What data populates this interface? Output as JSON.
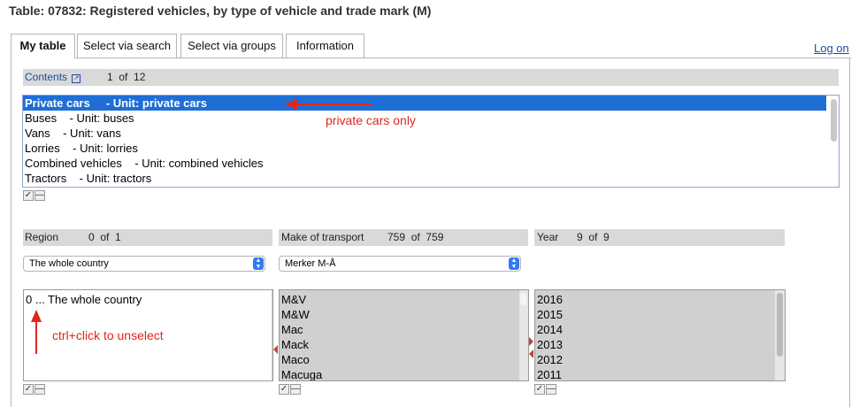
{
  "header": {
    "title": "Table: 07832: Registered vehicles, by type of vehicle and trade mark (M)"
  },
  "tabs": [
    {
      "label": "My table",
      "active": true
    },
    {
      "label": "Select via search",
      "active": false
    },
    {
      "label": "Select via groups",
      "active": false
    },
    {
      "label": "Information",
      "active": false
    }
  ],
  "logon": "Log on",
  "contents": {
    "label": "Contents",
    "selected": "1",
    "of": "of",
    "total": "12",
    "items": [
      "Private cars     - Unit: private cars",
      "Buses    - Unit: buses",
      "Vans    - Unit: vans",
      "Lorries    - Unit: lorries",
      "Combined vehicles    - Unit: combined vehicles",
      "Tractors    - Unit: tractors"
    ],
    "selected_index": 0
  },
  "annotations": {
    "private_cars": "private cars only",
    "ctrl_click": "ctrl+click to unselect"
  },
  "region": {
    "label": "Region",
    "selected": "0",
    "of": "of",
    "total": "1",
    "dropdown": "The whole country",
    "items": [
      "0 ... The whole country"
    ]
  },
  "make": {
    "label": "Make of transport",
    "selected": "759",
    "of": "of",
    "total": "759",
    "dropdown": "Merker M-Å",
    "items": [
      "M&V",
      "M&W",
      "Mac",
      "Mack",
      "Maco",
      "Macuga"
    ]
  },
  "year": {
    "label": "Year",
    "selected": "9",
    "of": "of",
    "total": "9",
    "items": [
      "2016",
      "2015",
      "2014",
      "2013",
      "2012",
      "2011"
    ]
  },
  "checks": {
    "all": "✓",
    "none": "—"
  },
  "colors": {
    "selection": "#1f6ed6",
    "annotation": "#e0261b",
    "link": "#1a4fa0"
  }
}
